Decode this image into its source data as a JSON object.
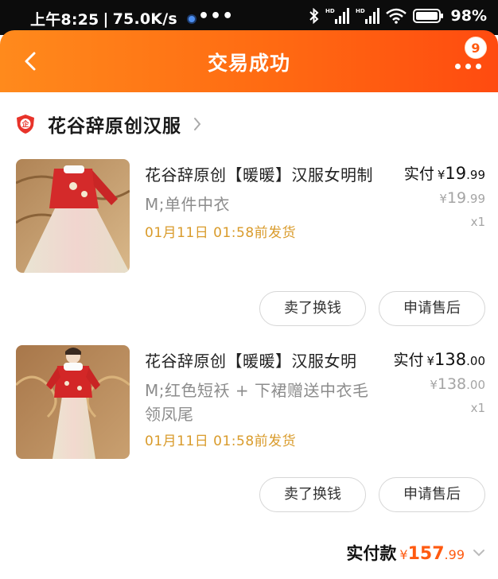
{
  "status_bar": {
    "time": "上午8:25",
    "speed": "75.0K/s",
    "separator": "|",
    "more": "•••",
    "battery": "98%"
  },
  "header": {
    "title": "交易成功",
    "badge_count": "9"
  },
  "shop": {
    "name": "花谷辞原创汉服"
  },
  "items": [
    {
      "title": "花谷辞原创【暖暖】汉服女明制",
      "sku": "M;单件中衣",
      "ship": "01月11日 01:58前发货",
      "paid_label": "实付",
      "paid_yen": "¥",
      "paid_int": "19",
      "paid_dec": ".99",
      "orig_yen": "¥",
      "orig_int": "19",
      "orig_dec": ".99",
      "qty": "x1",
      "btn_sell": "卖了换钱",
      "btn_after": "申请售后"
    },
    {
      "title": "花谷辞原创【暖暖】汉服女明",
      "sku": "M;红色短袄 + 下裙赠送中衣毛领凤尾",
      "ship": "01月11日 01:58前发货",
      "paid_label": "实付",
      "paid_yen": "¥",
      "paid_int": "138",
      "paid_dec": ".00",
      "orig_yen": "¥",
      "orig_int": "138",
      "orig_dec": ".00",
      "qty": "x1",
      "btn_sell": "卖了换钱",
      "btn_after": "申请售后"
    }
  ],
  "total": {
    "label": "实付款",
    "yen": "¥",
    "int": "157",
    "dec": ".99"
  },
  "colors": {
    "header_start": "#ff8a1c",
    "header_end": "#ff4b10",
    "price_accent": "#ff5a10",
    "ship_text": "#d99b2b"
  }
}
